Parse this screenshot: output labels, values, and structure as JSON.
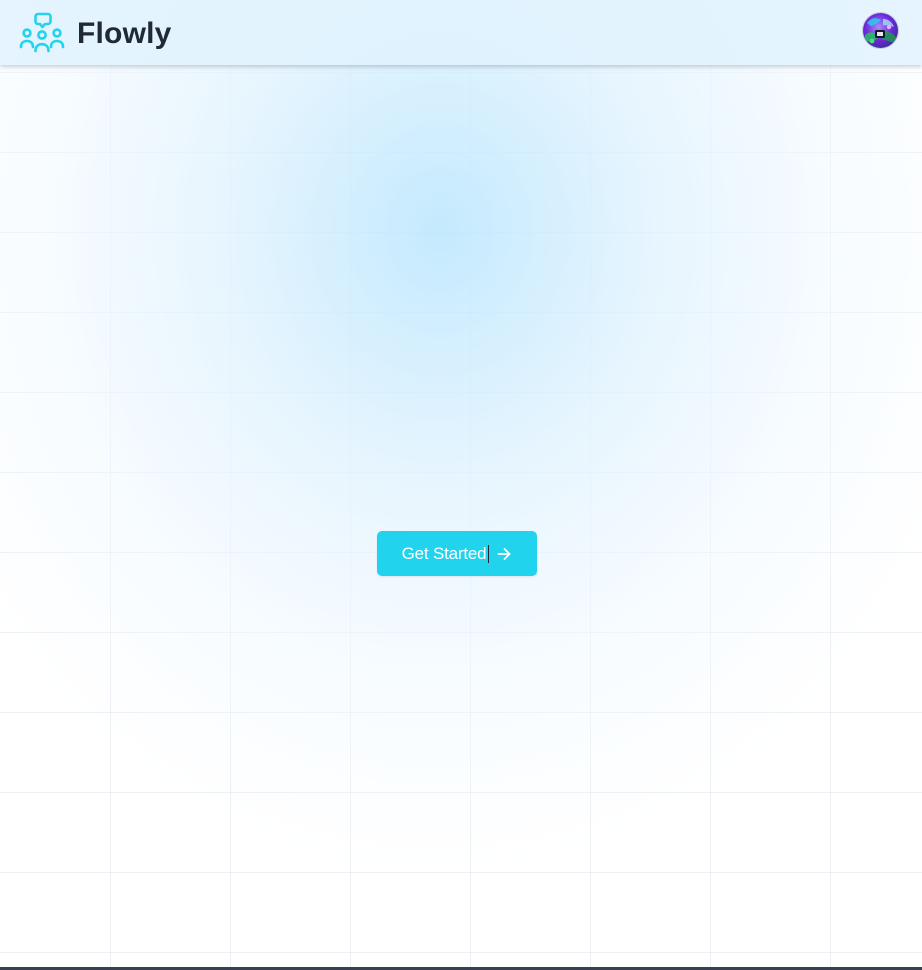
{
  "header": {
    "brand_name": "Flowly",
    "brand_icon": "team-chat-icon",
    "avatar": "user-avatar"
  },
  "hero": {
    "cta_label": "Get Started",
    "cta_icon": "arrow-right-icon"
  },
  "colors": {
    "accent": "#22d3ee",
    "brand_text": "#1f2937",
    "header_bg": "#e0f2fe",
    "glow": "#bae6fd"
  }
}
